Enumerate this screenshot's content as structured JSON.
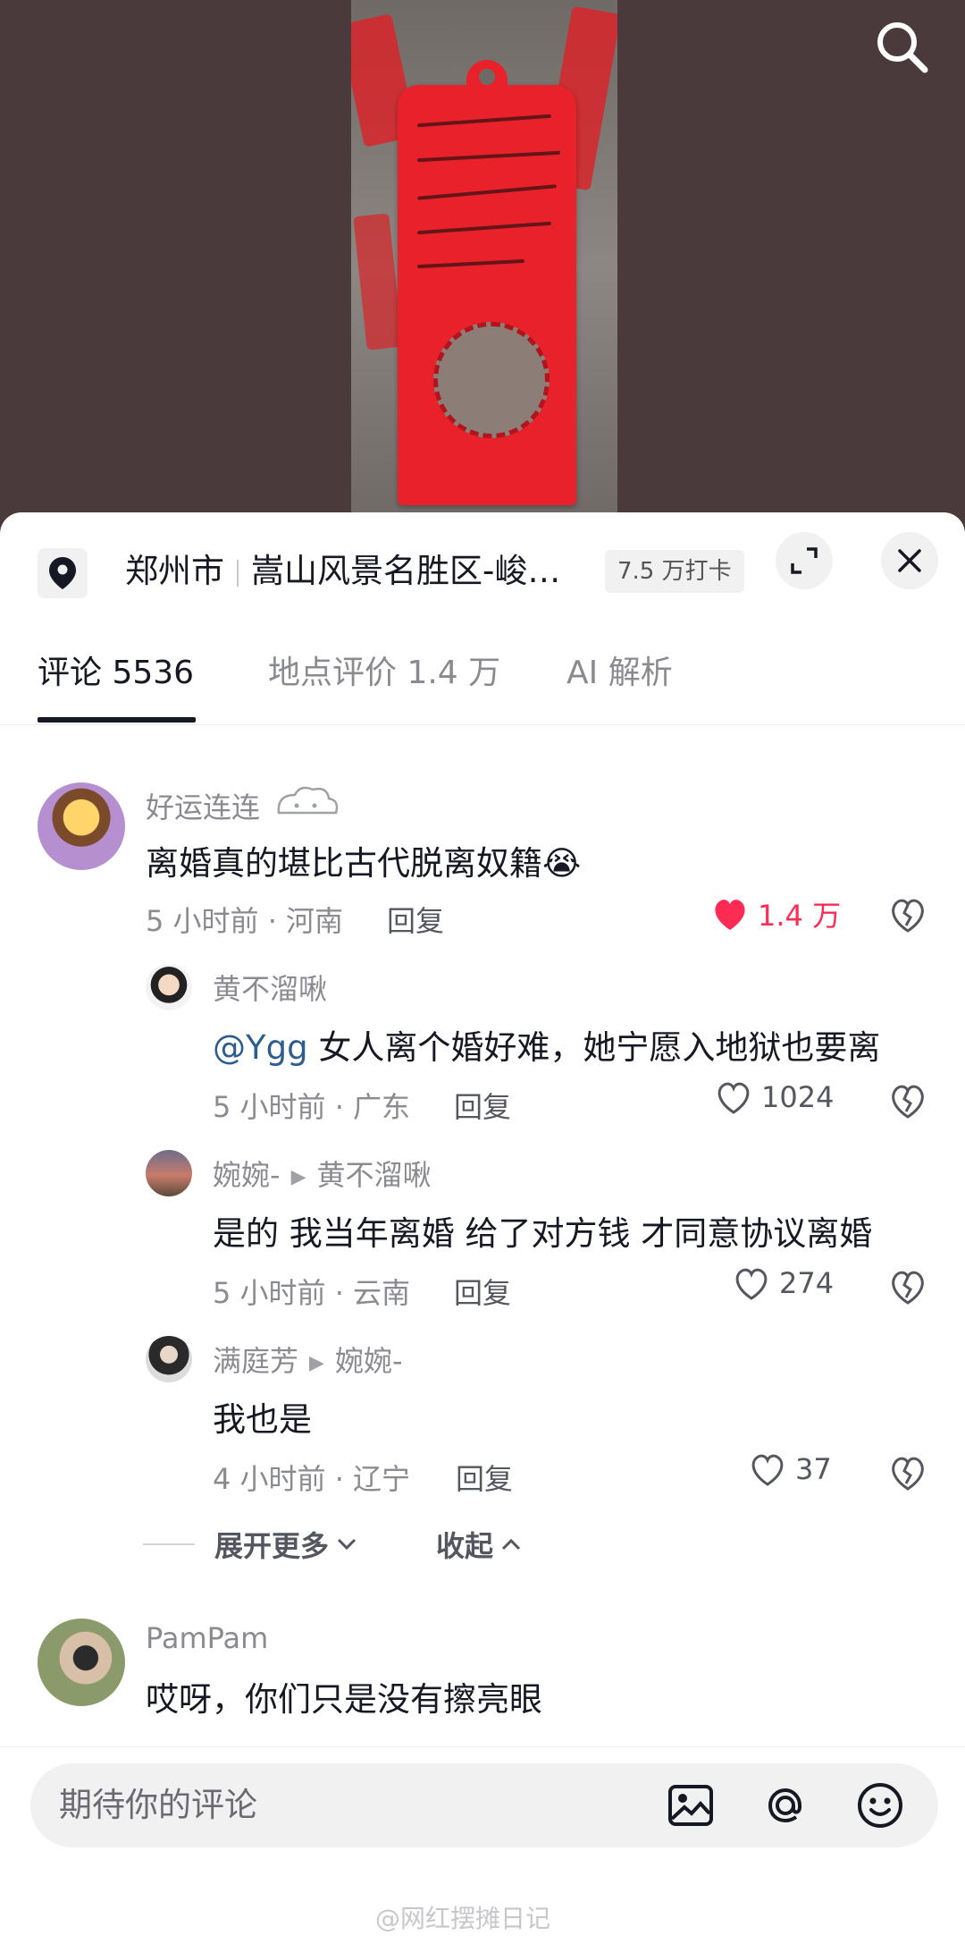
{
  "location": {
    "city": "郑州市",
    "place": "嵩山风景名胜区-峻…",
    "checkin": "7.5 万打卡"
  },
  "tabs": [
    {
      "label": "评论 5536",
      "active": true
    },
    {
      "label": "地点评价 1.4 万",
      "active": false
    },
    {
      "label": "AI 解析",
      "active": false
    }
  ],
  "comments": [
    {
      "user": "好运连连",
      "text": "离婚真的堪比古代脱离奴籍",
      "emoji": "😭",
      "time_place": "5 小时前 · 河南",
      "reply": "回复",
      "likes": "1.4 万",
      "liked": true
    },
    {
      "user": "黄不溜啾",
      "mention": "@Ygg",
      "text": " 女人离个婚好难，她宁愿入地狱也要离",
      "time_place": "5 小时前 · 广东",
      "reply": "回复",
      "likes": "1024"
    },
    {
      "user": "婉婉-",
      "reply_to": "黄不溜啾",
      "text": "是的 我当年离婚 给了对方钱 才同意协议离婚",
      "time_place": "5 小时前 · 云南",
      "reply": "回复",
      "likes": "274"
    },
    {
      "user": "满庭芳",
      "reply_to": "婉婉-",
      "text": "我也是",
      "time_place": "4 小时前 · 辽宁",
      "reply": "回复",
      "likes": "37"
    },
    {
      "user": "PamPam",
      "text": "哎呀，你们只是没有擦亮眼"
    }
  ],
  "expand": {
    "more": "展开更多",
    "collapse": "收起"
  },
  "input": {
    "placeholder": "期待你的评论"
  },
  "watermark": "@网红摆摊日记",
  "colors": {
    "accent_like": "#fe2c55",
    "mention": "#2f5c8f",
    "sheet_bg": "#ffffff",
    "video_bg": "#4a3a3c",
    "tag_red": "#e8212b"
  },
  "icons": [
    "search-icon",
    "location-pin-icon",
    "expand-icon",
    "close-icon",
    "heart-icon",
    "dislike-icon",
    "chevron-down-icon",
    "chevron-up-icon",
    "image-icon",
    "at-icon",
    "emoji-icon"
  ]
}
